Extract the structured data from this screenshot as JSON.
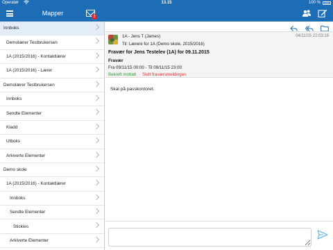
{
  "status": {
    "carrier": "Operatør",
    "time": "13.15",
    "battery": "100 %"
  },
  "nav": {
    "title": "Mapper",
    "unread_badge": "3"
  },
  "folders": [
    {
      "label": "Innboks",
      "indent": 0,
      "selected": true
    },
    {
      "label": "Demolærer Testbrukersen",
      "indent": 1
    },
    {
      "label": "1A (2015/2016) - Kontaktlærer",
      "indent": 1
    },
    {
      "label": "1A (2015/2016) - Lærer",
      "indent": 1
    },
    {
      "label": "Demolærer Testbrukersen",
      "indent": 0
    },
    {
      "label": "Innboks",
      "indent": 1
    },
    {
      "label": "Sendte Elementer",
      "indent": 1
    },
    {
      "label": "Kladd",
      "indent": 1
    },
    {
      "label": "Utboks",
      "indent": 1
    },
    {
      "label": "Arkiverte Elementer",
      "indent": 1
    },
    {
      "label": "Demo skole",
      "indent": 0
    },
    {
      "label": "1A (2015/2016) - Kontaktlærer",
      "indent": 1
    },
    {
      "label": "Innboks",
      "indent": 2
    },
    {
      "label": "Sendte Elementer",
      "indent": 2
    },
    {
      "label": "Stickies",
      "indent": 3
    },
    {
      "label": "Arkiverte Elementer",
      "indent": 2
    }
  ],
  "message": {
    "from": "1A - Jens T (James)",
    "date": "04/11/15 22:03:19",
    "to": "Til: Lærere for 1A (Demo skole, 2015/2016)",
    "subject": "Fravær for Jens Testelev (1A) for 09.11.2015",
    "section_title": "Fravær",
    "period": "Fra 09/11/15 00:00 - Til 09/11/15 23:00",
    "confirm_label": "Bekreft mottatt",
    "delete_label": "Slett fraværsmeldingen",
    "body": "Skal på passkontoret."
  },
  "composer": {
    "placeholder": ""
  },
  "icons": {
    "menu": "hamburger-icon",
    "mail": "envelope-icon",
    "contacts": "people-icon",
    "compose": "compose-icon",
    "reply": "reply-icon",
    "reply_all": "reply-all-icon",
    "folder": "folder-icon",
    "send": "send-icon"
  },
  "colors": {
    "brand": "#1c6cb6",
    "confirm": "#2e9a36",
    "delete": "#dd3333",
    "badge": "#e0262d",
    "selected_row": "#e4eef8"
  }
}
